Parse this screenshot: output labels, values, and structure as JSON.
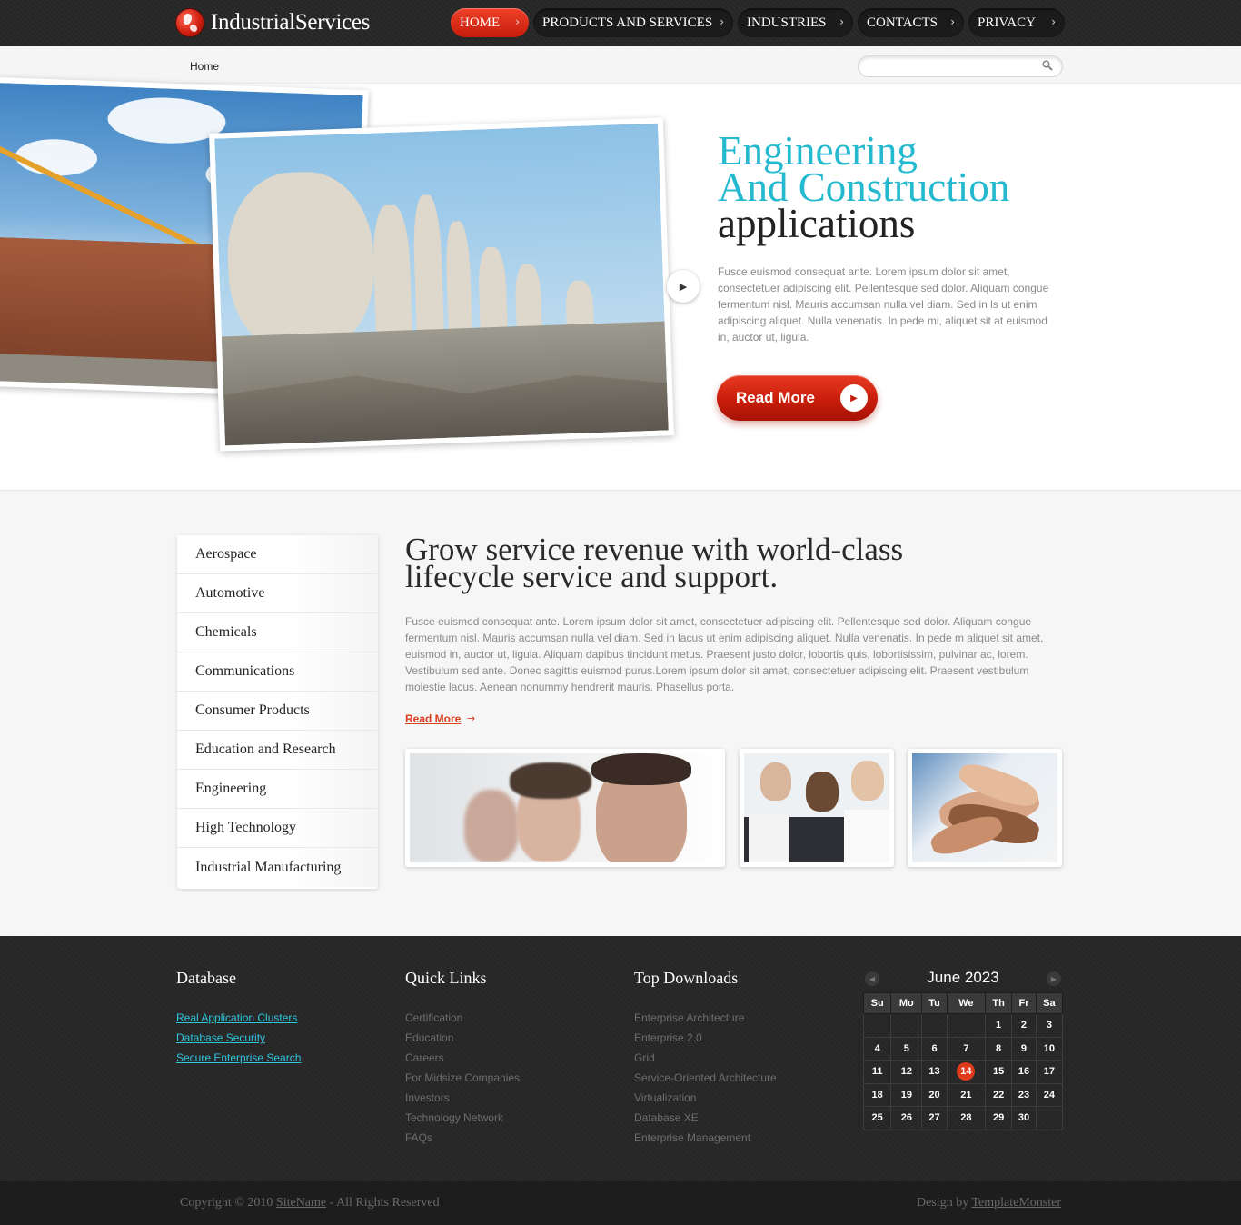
{
  "brand": {
    "name": "IndustrialServices"
  },
  "nav": {
    "items": [
      {
        "label": "HOME",
        "active": true
      },
      {
        "label": "PRODUCTS AND SERVICES",
        "active": false
      },
      {
        "label": "INDUSTRIES",
        "active": false
      },
      {
        "label": "CONTACTS",
        "active": false
      },
      {
        "label": "PRIVACY",
        "active": false
      }
    ]
  },
  "breadcrumb": {
    "current": "Home"
  },
  "search": {
    "value": "",
    "placeholder": ""
  },
  "hero": {
    "title_line1": "Engineering",
    "title_line2": "And Construction",
    "title_line3": "applications",
    "text": "Fusce euismod consequat ante. Lorem ipsum dolor sit amet, consectetuer adipiscing elit. Pellentesque sed dolor. Aliquam congue fermentum nisl. Mauris accumsan nulla vel diam. Sed in ls ut enim adipiscing aliquet. Nulla venenatis. In pede mi, aliquet sit at euismod in, auctor ut, ligula.",
    "button_label": "Read More"
  },
  "categories": [
    "Aerospace",
    "Automotive",
    "Chemicals",
    "Communications",
    "Consumer Products",
    "Education and Research",
    "Engineering",
    "High Technology",
    "Industrial Manufacturing"
  ],
  "main": {
    "title_line1": "Grow service revenue with world-class",
    "title_line2": "lifecycle service and support.",
    "text": "Fusce euismod consequat ante. Lorem ipsum dolor sit amet, consectetuer adipiscing elit. Pellentesque sed dolor. Aliquam congue fermentum nisl. Mauris accumsan nulla vel diam. Sed in lacus ut enim adipiscing aliquet. Nulla venenatis. In pede m aliquet sit amet, euismod in, auctor ut, ligula. Aliquam dapibus tincidunt metus. Praesent justo dolor, lobortis quis, lobortisissim, pulvinar ac, lorem. Vestibulum sed ante. Donec sagittis euismod purus.Lorem ipsum dolor sit amet, consectetuer adipiscing elit. Praesent vestibulum molestie lacus. Aenean nonummy hendrerit mauris. Phasellus porta.",
    "link_label": "Read More"
  },
  "footer": {
    "database": {
      "title": "Database",
      "links": [
        "Real Application Clusters",
        "Database Security",
        "Secure Enterprise Search"
      ]
    },
    "quick_links": {
      "title": "Quick Links",
      "links": [
        "Certification",
        "Education",
        "Careers",
        "For Midsize Companies",
        "Investors",
        "Technology Network",
        "FAQs"
      ]
    },
    "top_downloads": {
      "title": "Top Downloads",
      "links": [
        "Enterprise Architecture",
        "Enterprise 2.0",
        "Grid",
        "Service-Oriented Architecture",
        "Virtualization",
        "Database XE",
        "Enterprise Management"
      ]
    },
    "calendar": {
      "month": "June 2023",
      "weekdays": [
        "Su",
        "Mo",
        "Tu",
        "We",
        "Th",
        "Fr",
        "Sa"
      ],
      "weeks": [
        [
          "",
          "",
          "",
          "",
          "1",
          "2",
          "3"
        ],
        [
          "4",
          "5",
          "6",
          "7",
          "8",
          "9",
          "10"
        ],
        [
          "11",
          "12",
          "13",
          "14",
          "15",
          "16",
          "17"
        ],
        [
          "18",
          "19",
          "20",
          "21",
          "22",
          "23",
          "24"
        ],
        [
          "25",
          "26",
          "27",
          "28",
          "29",
          "30",
          ""
        ]
      ],
      "today": "14"
    }
  },
  "bottom": {
    "copyright_prefix": "Copyright © 2010",
    "site_name": "SiteName",
    "copyright_suffix": "- All Rights Reserved",
    "design_prefix": "Design by",
    "design_link": "TemplateMonster"
  },
  "colors": {
    "accent_red": "#d8401f",
    "accent_cyan": "#25b9cf",
    "dark": "#262626"
  }
}
